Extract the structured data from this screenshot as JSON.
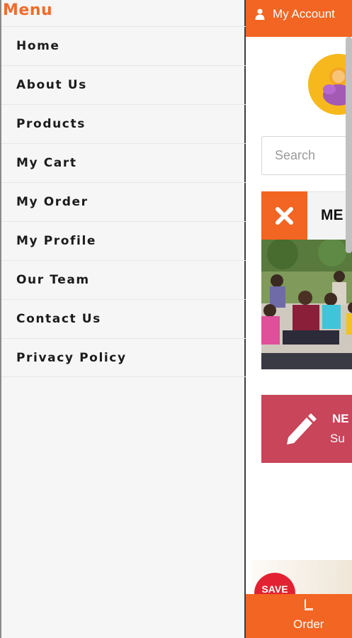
{
  "drawer": {
    "title": "Menu",
    "items": [
      {
        "label": "Home"
      },
      {
        "label": "About Us"
      },
      {
        "label": "Products"
      },
      {
        "label": "My Cart"
      },
      {
        "label": "My Order"
      },
      {
        "label": "My Profile"
      },
      {
        "label": "Our Team"
      },
      {
        "label": "Contact Us"
      },
      {
        "label": "Privacy Policy"
      }
    ]
  },
  "page": {
    "account": {
      "label": "My Account",
      "icon": "user-icon"
    },
    "search": {
      "placeholder": "Search"
    },
    "marquee": {
      "text": "ME",
      "close_icon": "close-icon"
    },
    "promo": {
      "title": "NE",
      "subtitle": "Su",
      "icon": "pencil-icon"
    },
    "badge": {
      "text": "SAVE"
    },
    "order": {
      "label": "Order",
      "icon": "book-icon"
    }
  },
  "colors": {
    "accent": "#f26522",
    "menu_title": "#f26b2a",
    "promo": "#c8455a",
    "badge": "#e22232"
  }
}
